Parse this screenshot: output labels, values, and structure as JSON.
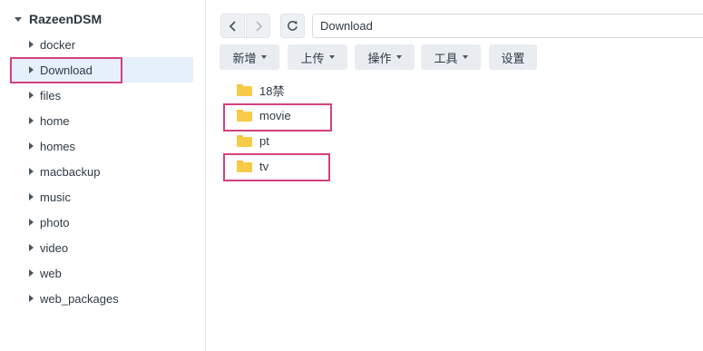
{
  "sidebar": {
    "root_label": "RazeenDSM",
    "items": [
      {
        "label": "docker"
      },
      {
        "label": "Download",
        "selected": true
      },
      {
        "label": "files"
      },
      {
        "label": "home"
      },
      {
        "label": "homes"
      },
      {
        "label": "macbackup"
      },
      {
        "label": "music"
      },
      {
        "label": "photo"
      },
      {
        "label": "video"
      },
      {
        "label": "web"
      },
      {
        "label": "web_packages"
      }
    ]
  },
  "toolbar": {
    "path": "Download",
    "buttons": [
      {
        "label": "新增",
        "has_dropdown": true
      },
      {
        "label": "上传",
        "has_dropdown": true
      },
      {
        "label": "操作",
        "has_dropdown": true
      },
      {
        "label": "工具",
        "has_dropdown": true
      },
      {
        "label": "设置",
        "has_dropdown": false
      }
    ]
  },
  "files": [
    {
      "name": "18禁",
      "type": "folder"
    },
    {
      "name": "movie",
      "type": "folder"
    },
    {
      "name": "pt",
      "type": "folder"
    },
    {
      "name": "tv",
      "type": "folder"
    }
  ],
  "colors": {
    "highlight": "#d4417e",
    "selected_bg": "#e5f0fb",
    "folder": "#f7cb47"
  }
}
